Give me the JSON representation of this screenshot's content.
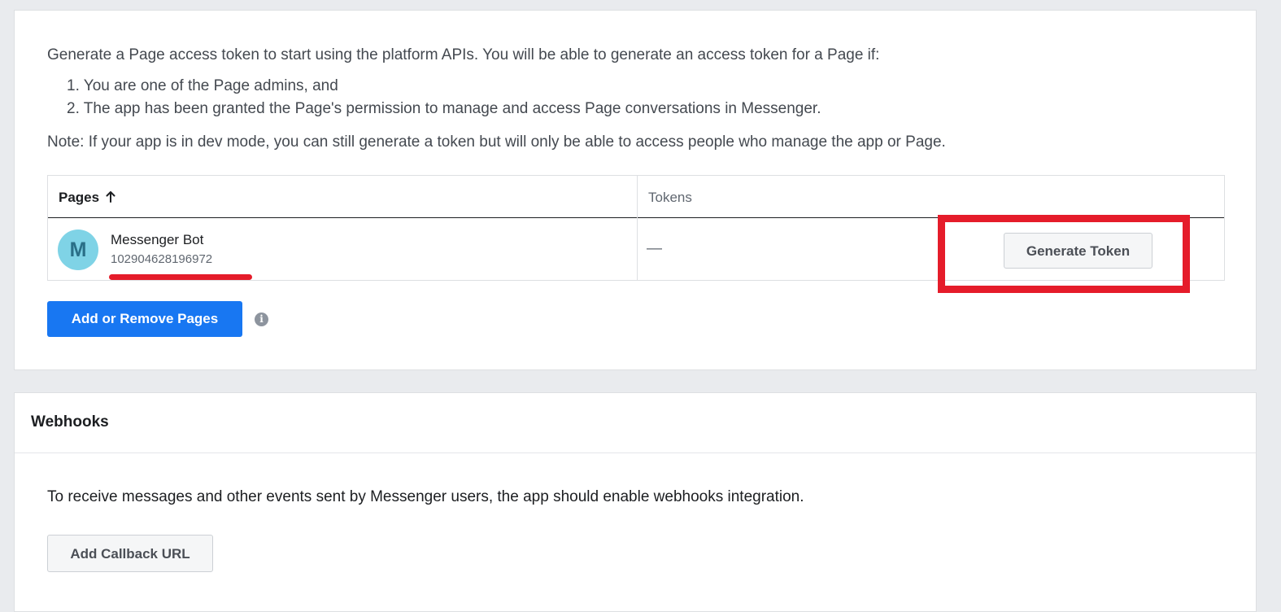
{
  "access_token_section": {
    "intro": "Generate a Page access token to start using the platform APIs. You will be able to generate an access token for a Page if:",
    "conditions": [
      "1. You are one of the Page admins, and",
      "2. The app has been granted the Page's permission to manage and access Page conversations in Messenger."
    ],
    "note": "Note: If your app is in dev mode, you can still generate a token but will only be able to access people who manage the app or Page.",
    "table": {
      "headers": {
        "pages": "Pages",
        "tokens": "Tokens"
      },
      "sort_icon": "arrow-up-icon",
      "rows": [
        {
          "avatar_letter": "M",
          "page_name": "Messenger Bot",
          "page_id": "102904628196972",
          "token": "—",
          "action_label": "Generate Token"
        }
      ]
    },
    "add_pages_label": "Add or Remove Pages",
    "info_icon": "info-icon",
    "info_icon_glyph": "i"
  },
  "webhooks_section": {
    "title": "Webhooks",
    "description": "To receive messages and other events sent by Messenger users, the app should enable webhooks integration.",
    "add_callback_label": "Add Callback URL"
  },
  "colors": {
    "primary_button": "#1877f2",
    "annotation_red": "#e51c2a",
    "avatar_bg": "#7fd3e6",
    "page_bg": "#e9ebee"
  }
}
